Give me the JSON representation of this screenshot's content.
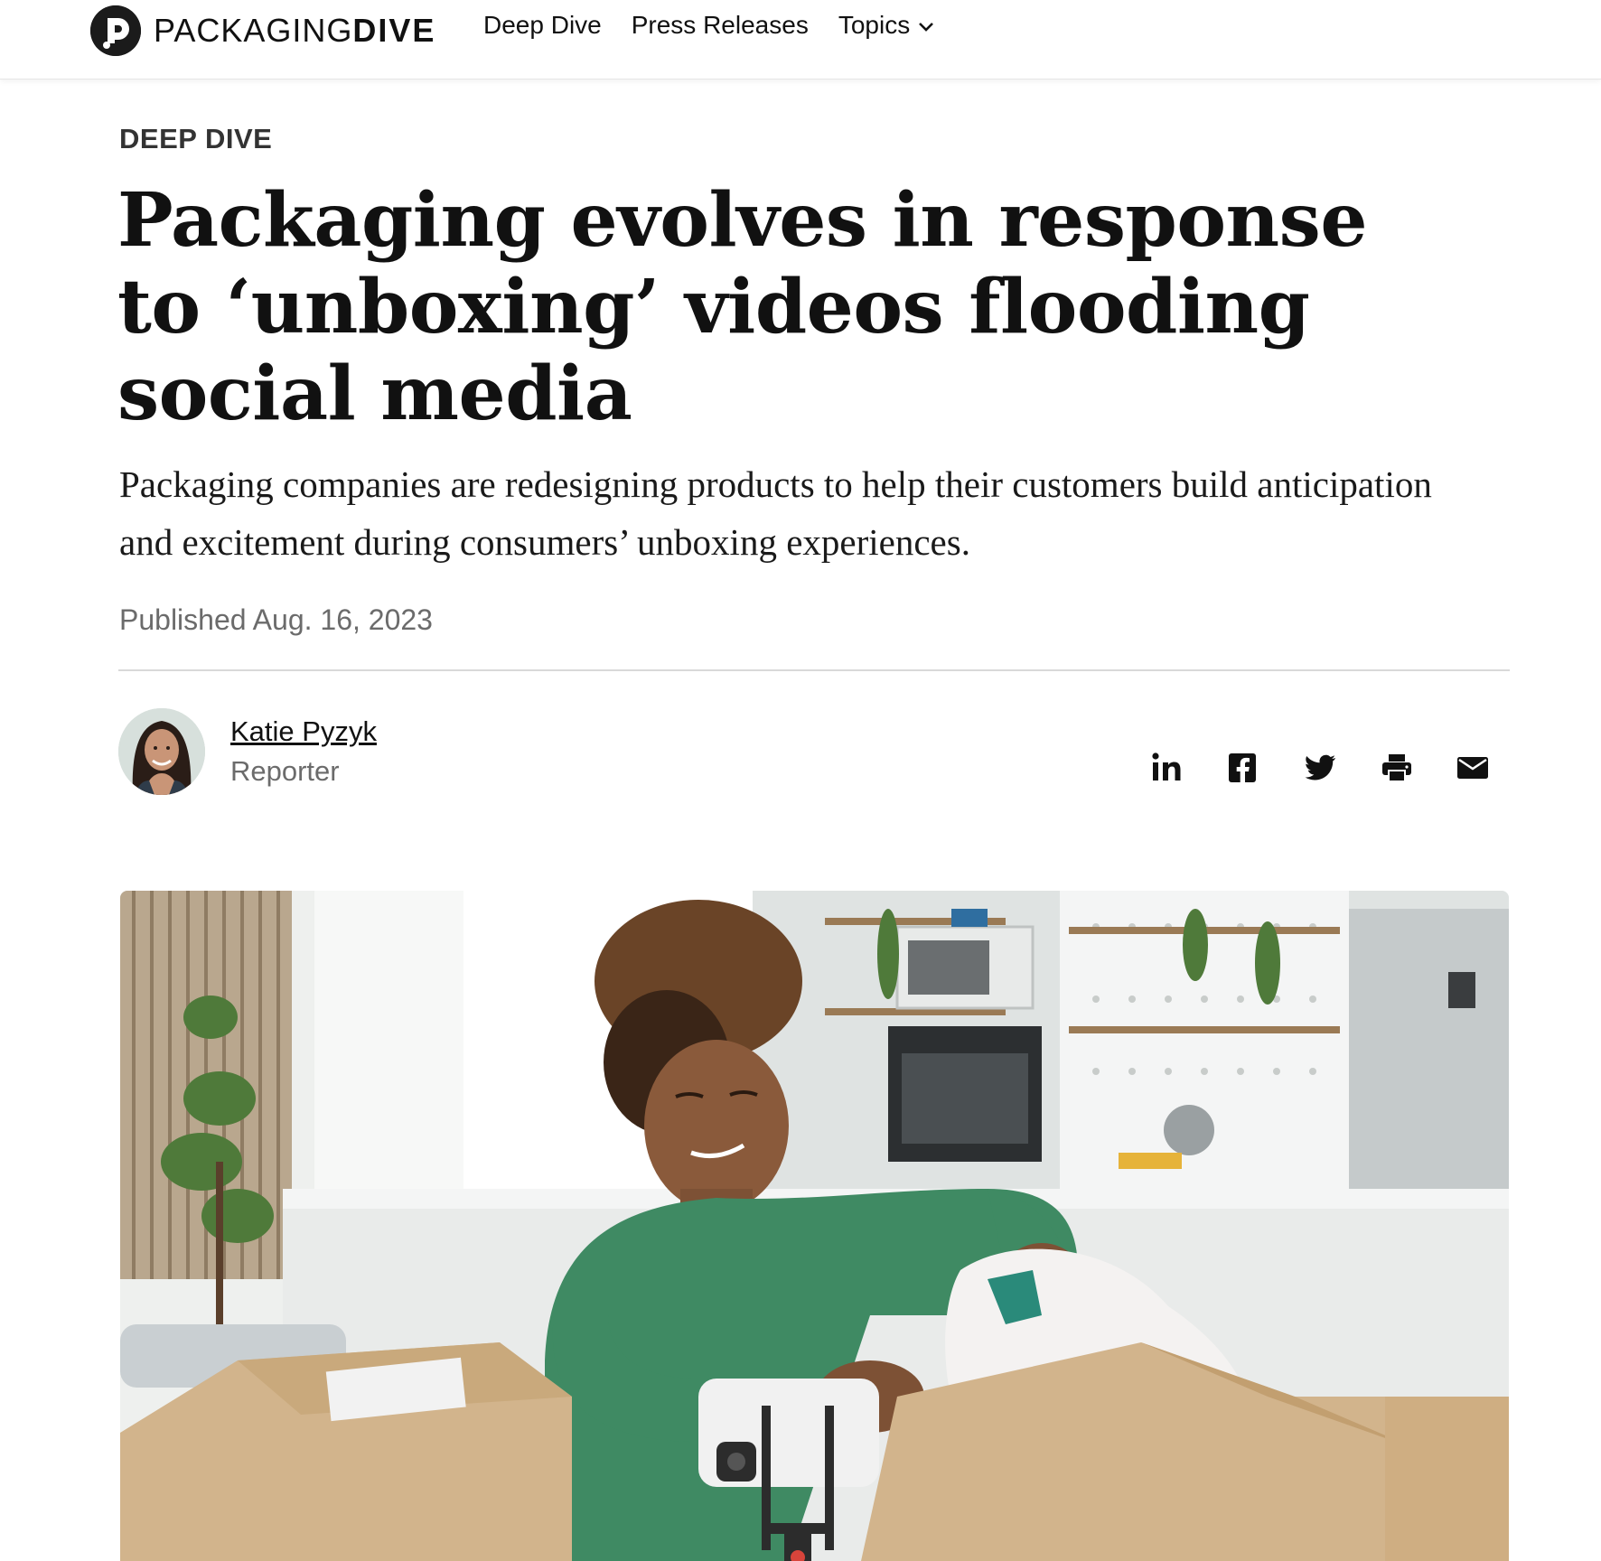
{
  "site": {
    "logo_light": "PACKAGING",
    "logo_bold": "DIVE"
  },
  "nav": {
    "items": [
      "Deep Dive",
      "Press Releases",
      "Topics"
    ]
  },
  "article": {
    "kicker": "DEEP DIVE",
    "headline": "Packaging evolves in response to ‘unboxing’ videos flooding social media",
    "dek": "Packaging companies are redesigning products to help their customers build anticipation and excitement during consumers’ unboxing experiences.",
    "published": "Published Aug. 16, 2023"
  },
  "author": {
    "name": "Katie Pyzyk",
    "title": "Reporter"
  },
  "share_icons": [
    "linkedin-icon",
    "facebook-icon",
    "twitter-icon",
    "print-icon",
    "email-icon"
  ],
  "colors": {
    "text": "#111111",
    "muted": "#6b6b6b",
    "rule": "#d9d9d9",
    "sweater": "#3f8a63",
    "box": "#d2b48c"
  }
}
